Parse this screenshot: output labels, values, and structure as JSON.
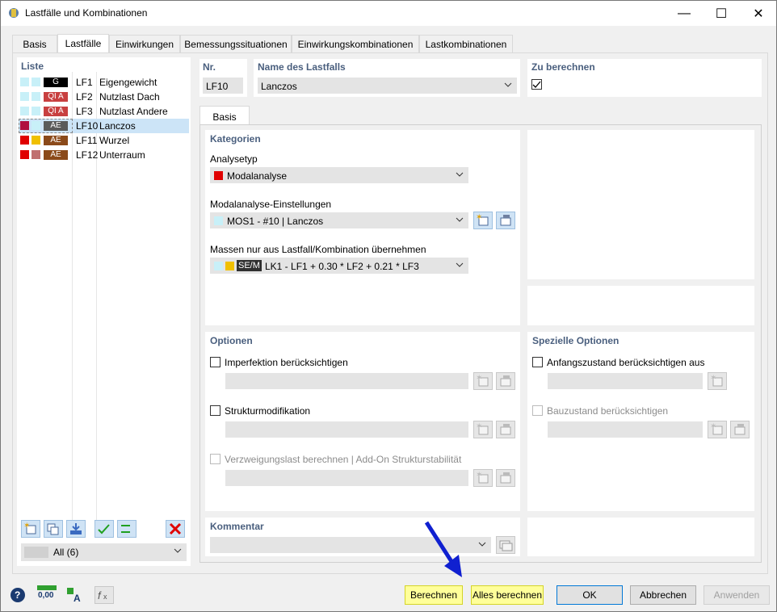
{
  "window": {
    "title": "Lastfälle und Kombinationen",
    "minimize": "—",
    "maximize": "☐",
    "close": "✕"
  },
  "tabs": [
    {
      "label": "Basis"
    },
    {
      "label": "Lastfälle",
      "active": true
    },
    {
      "label": "Einwirkungen"
    },
    {
      "label": "Bemessungssituationen"
    },
    {
      "label": "Einwirkungskombinationen"
    },
    {
      "label": "Lastkombinationen"
    }
  ],
  "list": {
    "title": "Liste",
    "items": [
      {
        "tag": "G",
        "tag_color": "#000000",
        "c1": "#c8f0f8",
        "c2": "#c8f0f8",
        "id": "LF1",
        "name": "Eigengewicht"
      },
      {
        "tag": "QI A",
        "tag_color": "#c84040",
        "c1": "#c8f0f8",
        "c2": "#c8f0f8",
        "id": "LF2",
        "name": "Nutzlast Dach"
      },
      {
        "tag": "QI A",
        "tag_color": "#c84040",
        "c1": "#c8f0f8",
        "c2": "#c8f0f8",
        "id": "LF3",
        "name": "Nutzlast Andere"
      },
      {
        "tag": "AE",
        "tag_color": "#5a5a5a",
        "c1": "#b01040",
        "c2": "#c8f0f8",
        "id": "LF10",
        "name": "Lanczos",
        "selected": true
      },
      {
        "tag": "AE",
        "tag_color": "#8b4a1a",
        "c1": "#e00000",
        "c2": "#f0c000",
        "id": "LF11",
        "name": "Wurzel"
      },
      {
        "tag": "AE",
        "tag_color": "#8b4a1a",
        "c1": "#e00000",
        "c2": "#c07070",
        "id": "LF12",
        "name": "Unterraum"
      }
    ],
    "filter": "All (6)"
  },
  "header": {
    "nr_label": "Nr.",
    "nr_value": "LF10",
    "name_label": "Name des Lastfalls",
    "name_value": "Lanczos",
    "calc_label": "Zu berechnen",
    "calc_checked": "☑"
  },
  "inner_tab": "Basis",
  "kategorien": {
    "title": "Kategorien",
    "analysetyp_label": "Analysetyp",
    "analysetyp_value": "Modalanalyse",
    "analysetyp_color": "#e00000",
    "modal_label": "Modalanalyse-Einstellungen",
    "modal_value": "MOS1 - #10 | Lanczos",
    "massen_label": "Massen nur aus Lastfall/Kombination  übernehmen",
    "massen_tag": "SE/M",
    "massen_value": "LK1 - LF1 + 0.30 * LF2 + 0.21 * LF3"
  },
  "optionen": {
    "title": "Optionen",
    "imperfektion": "Imperfektion berücksichtigen",
    "struktur": "Strukturmodifikation",
    "verzweigung": "Verzweigungslast berechnen | Add-On Strukturstabilität"
  },
  "spezielle": {
    "title": "Spezielle Optionen",
    "anfang": "Anfangszustand berücksichtigen aus",
    "bauzustand": "Bauzustand berücksichtigen"
  },
  "kommentar": {
    "title": "Kommentar"
  },
  "footer": {
    "berechnen": "Berechnen",
    "alles": "Alles berechnen",
    "ok": "OK",
    "abbrechen": "Abbrechen",
    "anwenden": "Anwenden",
    "units": "0,00"
  }
}
